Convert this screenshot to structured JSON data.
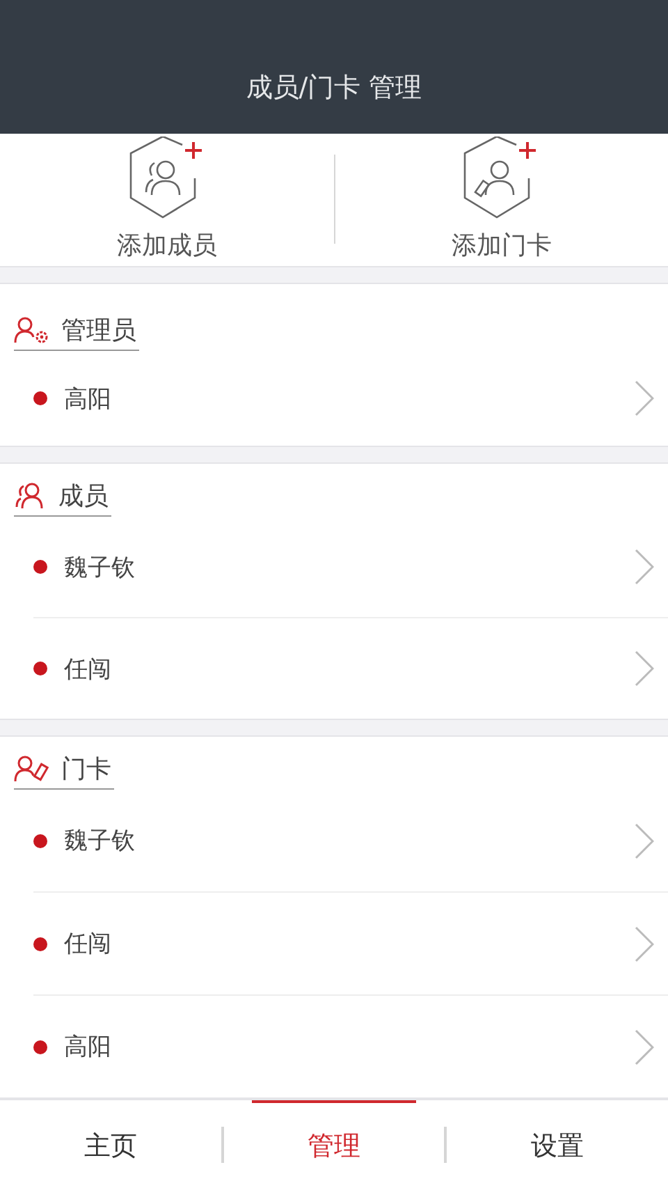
{
  "header": {
    "title": "成员/门卡 管理"
  },
  "actions": [
    {
      "kind": "member",
      "label": "添加成员"
    },
    {
      "kind": "card",
      "label": "添加门卡"
    }
  ],
  "sections": [
    {
      "kind": "admin",
      "title": "管理员",
      "items": [
        "高阳"
      ]
    },
    {
      "kind": "member",
      "title": "成员",
      "items": [
        "魏子钦",
        "任闯"
      ]
    },
    {
      "kind": "card",
      "title": "门卡",
      "items": [
        "魏子钦",
        "任闯",
        "高阳"
      ]
    }
  ],
  "tabs": [
    {
      "label": "主页",
      "selected": false
    },
    {
      "label": "管理",
      "selected": true
    },
    {
      "label": "设置",
      "selected": false
    }
  ]
}
